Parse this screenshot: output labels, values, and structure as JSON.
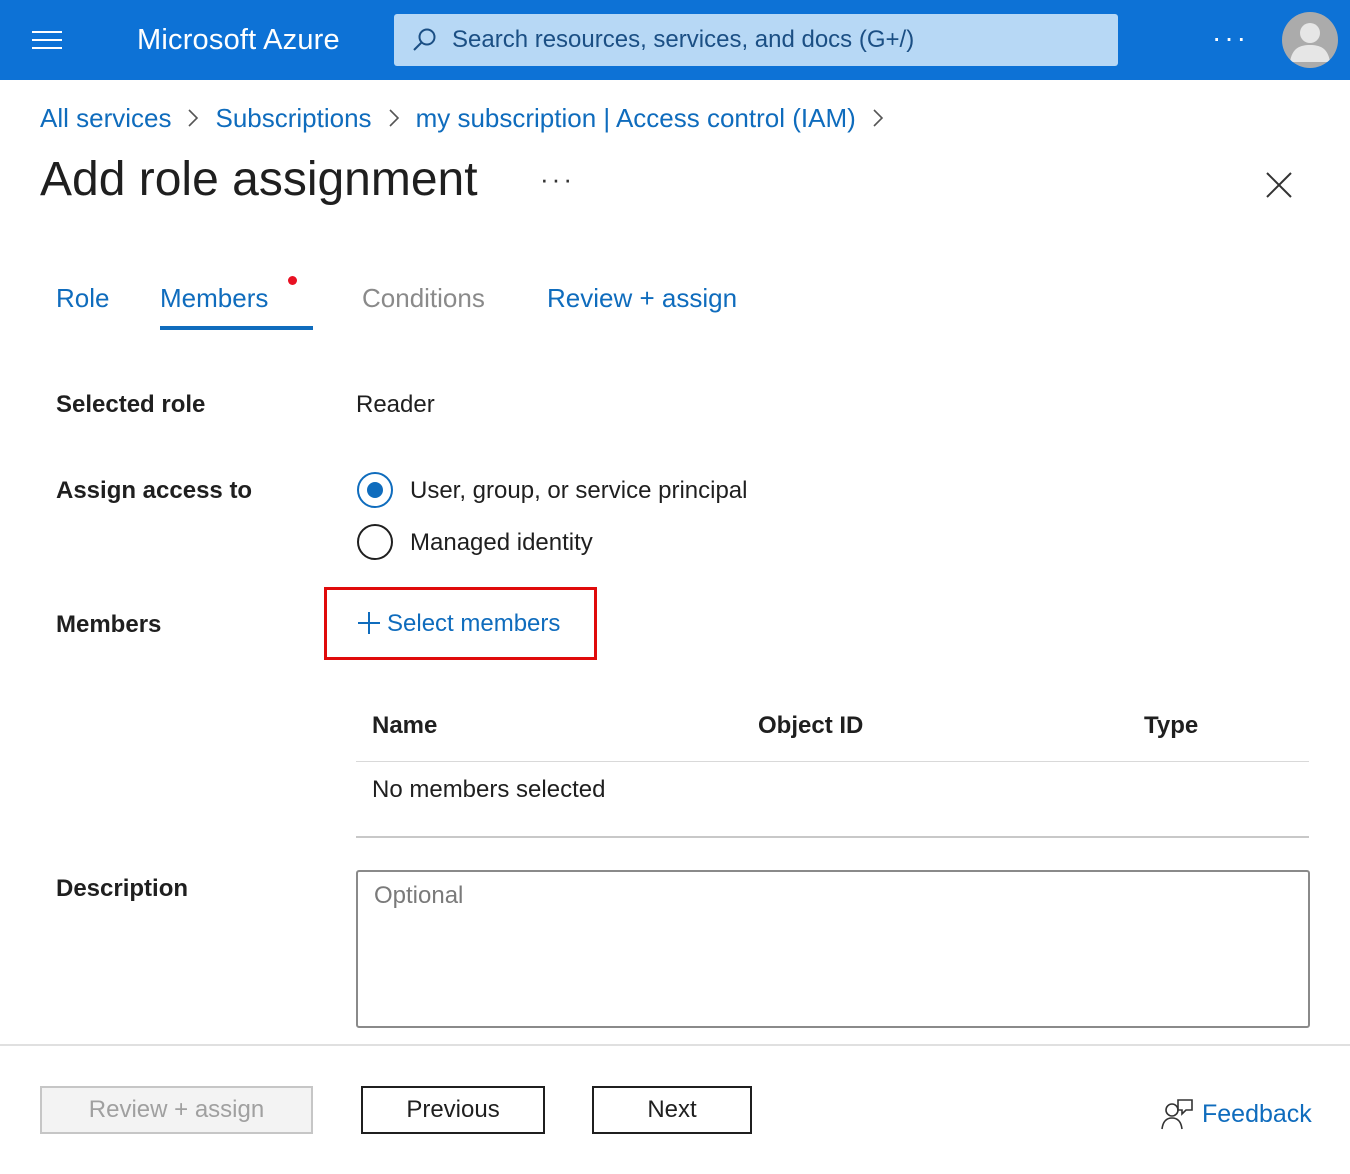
{
  "topbar": {
    "brand": "Microsoft Azure",
    "search_placeholder": "Search resources, services, and docs (G+/)",
    "more_label": "···"
  },
  "breadcrumb": [
    {
      "label": "All services"
    },
    {
      "label": "Subscriptions"
    },
    {
      "label": "my subscription | Access control (IAM)"
    }
  ],
  "page": {
    "title": "Add role assignment",
    "more_label": "···"
  },
  "tabs": [
    {
      "label": "Role",
      "state": "link"
    },
    {
      "label": "Members",
      "state": "active",
      "has_indicator": true
    },
    {
      "label": "Conditions",
      "state": "disabled"
    },
    {
      "label": "Review + assign",
      "state": "link"
    }
  ],
  "form": {
    "selected_role_label": "Selected role",
    "selected_role_value": "Reader",
    "assign_access_label": "Assign access to",
    "assign_options": [
      {
        "label": "User, group, or service principal",
        "checked": true
      },
      {
        "label": "Managed identity",
        "checked": false
      }
    ],
    "members_label": "Members",
    "select_members_label": "Select members",
    "table": {
      "columns": [
        "Name",
        "Object ID",
        "Type"
      ],
      "empty_text": "No members selected"
    },
    "description_label": "Description",
    "description_placeholder": "Optional"
  },
  "footer": {
    "review_assign_label": "Review + assign",
    "previous_label": "Previous",
    "next_label": "Next",
    "feedback_label": "Feedback"
  },
  "colors": {
    "topbar": "#0d72d6",
    "link": "#0f6cbd",
    "highlight_box": "#e00b0b",
    "tab_indicator": "#e81123"
  }
}
